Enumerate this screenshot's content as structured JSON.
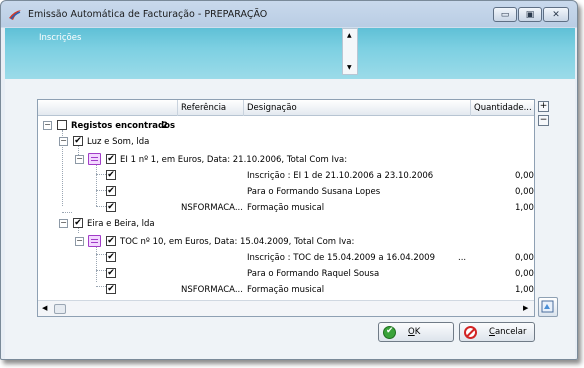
{
  "window": {
    "title": "Emissão Automática de Facturação - PREPARAÇÃO",
    "minimize_glyph": "▭",
    "maximize_glyph": "▣",
    "close_glyph": "✕",
    "app_icon": "app-logo-icon"
  },
  "header": {
    "label": "Inscrições"
  },
  "grid": {
    "columns": [
      "Referência",
      "Designação",
      "Quantidade..."
    ],
    "root": {
      "label": "Registos encontrados",
      "count": "2"
    },
    "groups": [
      {
        "client": "Luz e Som, lda",
        "document": "EI 1 nº 1, em Euros, Data: 21.10.2006, Total Com Iva:",
        "lines": [
          {
            "ref": "",
            "desc": "Inscrição : EI 1 de 21.10.2006 a 23.10.2006",
            "extra": "",
            "qty": "0,00"
          },
          {
            "ref": "",
            "desc": "Para o Formando Susana Lopes",
            "extra": "",
            "qty": "0,00"
          },
          {
            "ref": "NSFORMACA...",
            "desc": "Formação musical",
            "extra": "",
            "qty": "1,00"
          }
        ]
      },
      {
        "client": "Eira e Beira, lda",
        "document": "TOC nº 10, em Euros, Data: 15.04.2009, Total Com Iva:",
        "lines": [
          {
            "ref": "",
            "desc": "Inscrição : TOC de 15.04.2009 a 16.04.2009",
            "extra": "...",
            "qty": "0,00"
          },
          {
            "ref": "",
            "desc": "Para o Formando Raquel Sousa",
            "extra": "",
            "qty": "0,00"
          },
          {
            "ref": "NSFORMACA...",
            "desc": "Formação musical",
            "extra": "",
            "qty": "1,00"
          }
        ]
      }
    ],
    "check_glyph": "✔",
    "collapse_glyph": "−"
  },
  "side": {
    "expand": "+",
    "collapse": "−"
  },
  "buttons": {
    "ok": {
      "label_u": "O",
      "label_rest": "K"
    },
    "cancel": {
      "label_u": "C",
      "label_rest": "ancelar"
    }
  }
}
